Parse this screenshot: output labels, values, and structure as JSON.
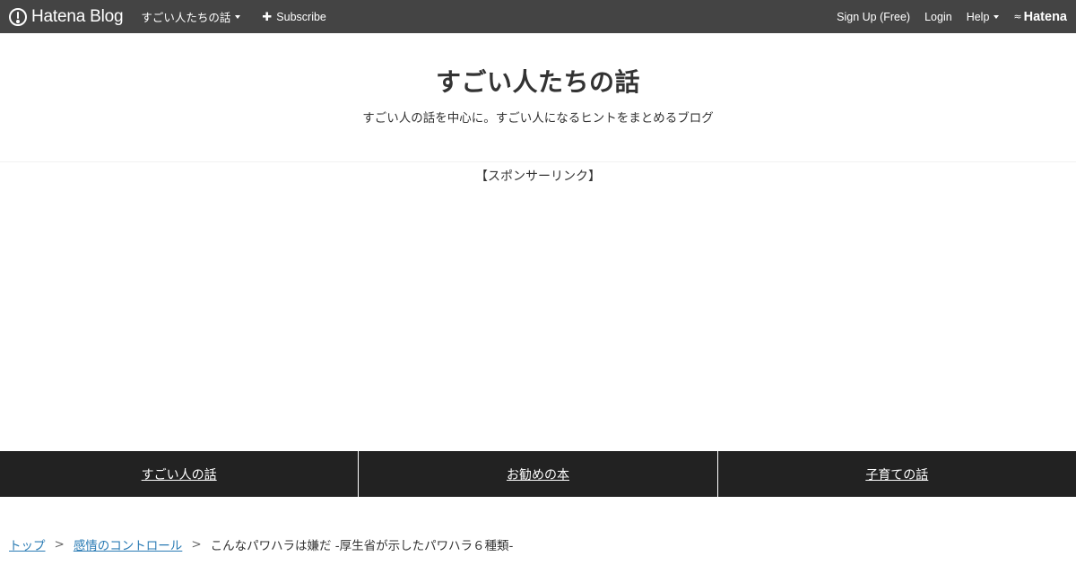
{
  "globalheader": {
    "brand": "Hatena Blog",
    "blog_menu": "すごい人たちの話",
    "subscribe": "Subscribe",
    "signup": "Sign Up (Free)",
    "login": "Login",
    "help": "Help",
    "hatena": "Hatena"
  },
  "blog": {
    "title": "すごい人たちの話",
    "description": "すごい人の話を中心に。すごい人になるヒントをまとめるブログ"
  },
  "sponsored": "【スポンサーリンク】",
  "categories": [
    "すごい人の話",
    "お勧めの本",
    "子育ての話"
  ],
  "breadcrumb": {
    "items": [
      "トップ",
      "感情のコントロール"
    ],
    "separator": ">",
    "current": "こんなパワハラは嫌だ -厚生省が示したパワハラ６種類-"
  }
}
